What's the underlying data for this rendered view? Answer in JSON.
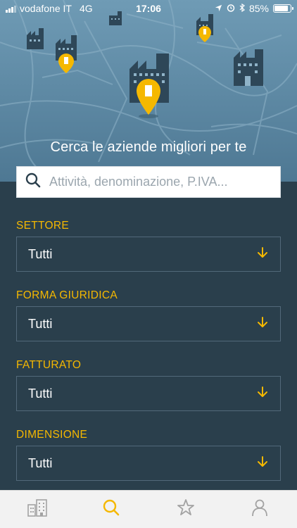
{
  "status": {
    "carrier": "vodafone IT",
    "network": "4G",
    "time": "17:06",
    "battery": "85%",
    "battery_level": 0.85
  },
  "hero": {
    "title": "Cerca le aziende migliori per te"
  },
  "search": {
    "placeholder": "Attività, denominazione, P.IVA..."
  },
  "filters": [
    {
      "label": "SETTORE",
      "value": "Tutti"
    },
    {
      "label": "FORMA GIURIDICA",
      "value": "Tutti"
    },
    {
      "label": "FATTURATO",
      "value": "Tutti"
    },
    {
      "label": "DIMENSIONE",
      "value": "Tutti"
    }
  ],
  "tabbar": {
    "items": [
      {
        "icon": "buildings-icon",
        "active": false
      },
      {
        "icon": "search-icon",
        "active": true
      },
      {
        "icon": "star-icon",
        "active": false
      },
      {
        "icon": "user-icon",
        "active": false
      }
    ]
  },
  "colors": {
    "accent": "#f5b800",
    "background": "#2a3f4c",
    "hero": "#6f9bb5",
    "building": "#2e4758"
  }
}
